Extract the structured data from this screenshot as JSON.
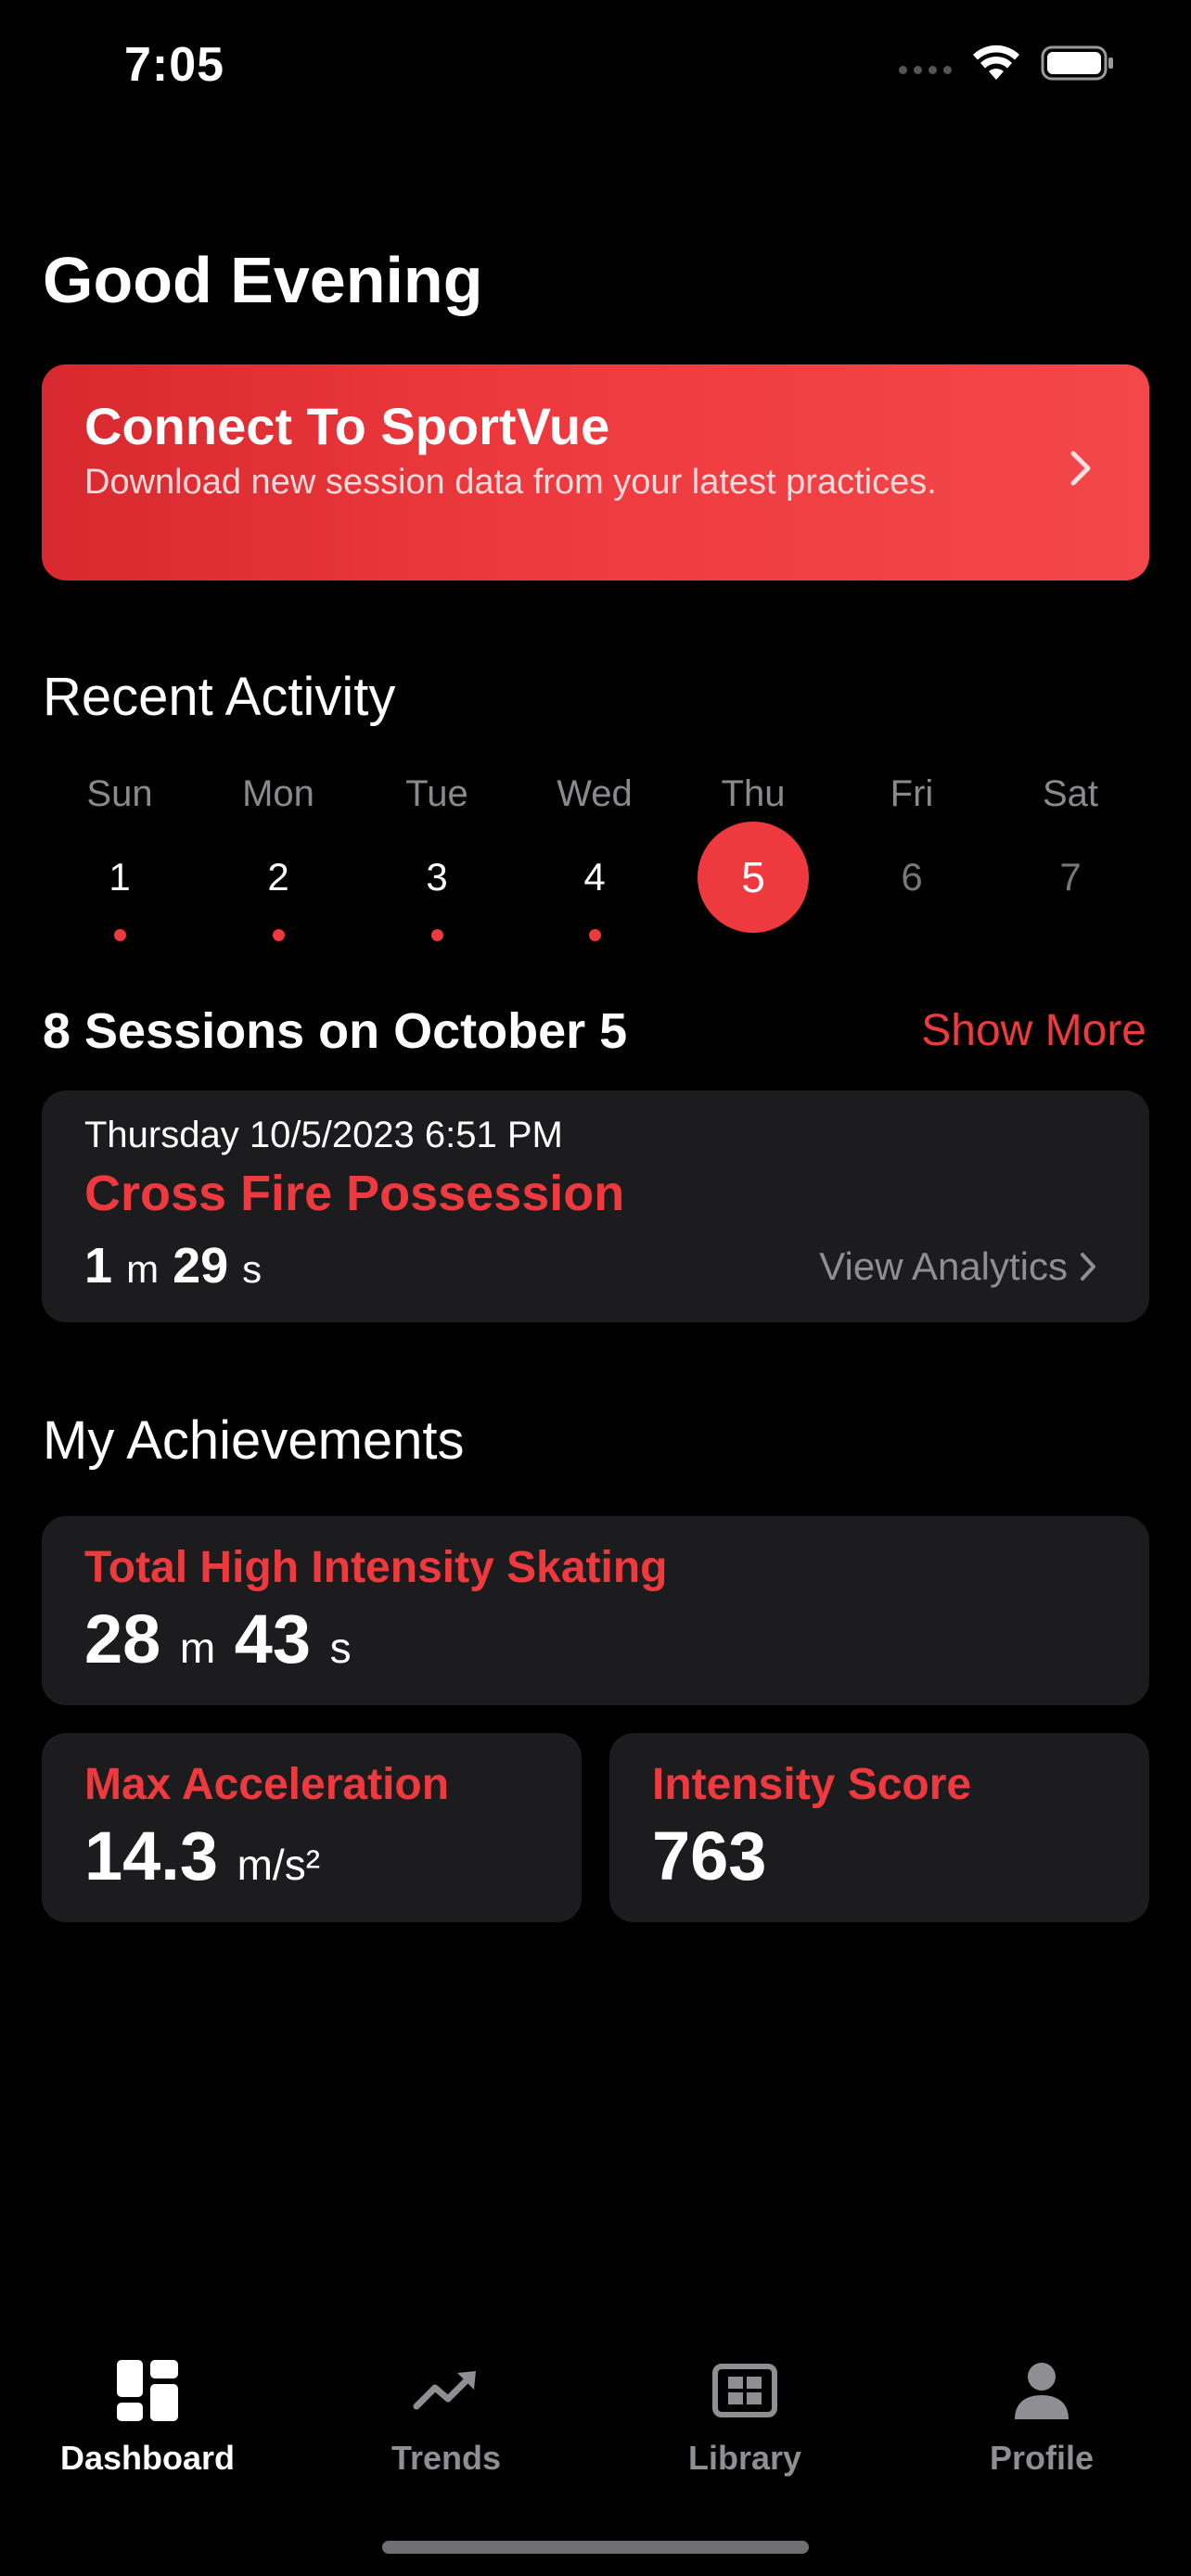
{
  "status_bar": {
    "time": "7:05"
  },
  "greeting": "Good Evening",
  "connect_card": {
    "title": "Connect To SportVue",
    "subtitle": "Download new session data from your latest practices."
  },
  "recent_activity": {
    "title": "Recent Activity",
    "days": [
      {
        "name": "Sun",
        "date": "1",
        "has_activity": true,
        "selected": false
      },
      {
        "name": "Mon",
        "date": "2",
        "has_activity": true,
        "selected": false
      },
      {
        "name": "Tue",
        "date": "3",
        "has_activity": true,
        "selected": false
      },
      {
        "name": "Wed",
        "date": "4",
        "has_activity": true,
        "selected": false
      },
      {
        "name": "Thu",
        "date": "5",
        "has_activity": false,
        "selected": true
      },
      {
        "name": "Fri",
        "date": "6",
        "has_activity": false,
        "selected": false
      },
      {
        "name": "Sat",
        "date": "7",
        "has_activity": false,
        "selected": false
      }
    ]
  },
  "sessions": {
    "title": "8 Sessions on October 5",
    "show_more": "Show More",
    "card": {
      "datetime": "Thursday 10/5/2023 6:51 PM",
      "name": "Cross Fire Possession",
      "minutes": "1",
      "minutes_unit": "m",
      "seconds": "29",
      "seconds_unit": "s",
      "link": "View Analytics"
    }
  },
  "achievements": {
    "title": "My Achievements",
    "total_skating": {
      "label": "Total High Intensity Skating",
      "minutes": "28",
      "minutes_unit": "m",
      "seconds": "43",
      "seconds_unit": "s"
    },
    "max_acceleration": {
      "label": "Max Acceleration",
      "value": "14.3",
      "unit": "m/s²"
    },
    "intensity_score": {
      "label": "Intensity Score",
      "value": "763"
    }
  },
  "tab_bar": {
    "tabs": [
      {
        "label": "Dashboard",
        "icon": "dashboard-icon",
        "active": true
      },
      {
        "label": "Trends",
        "icon": "trend-icon",
        "active": false
      },
      {
        "label": "Library",
        "icon": "library-icon",
        "active": false
      },
      {
        "label": "Profile",
        "icon": "profile-icon",
        "active": false
      }
    ]
  },
  "colors": {
    "accent": "#ee3a3e",
    "card": "#1c1c1e",
    "background": "#000000",
    "muted": "#8e8e93"
  }
}
